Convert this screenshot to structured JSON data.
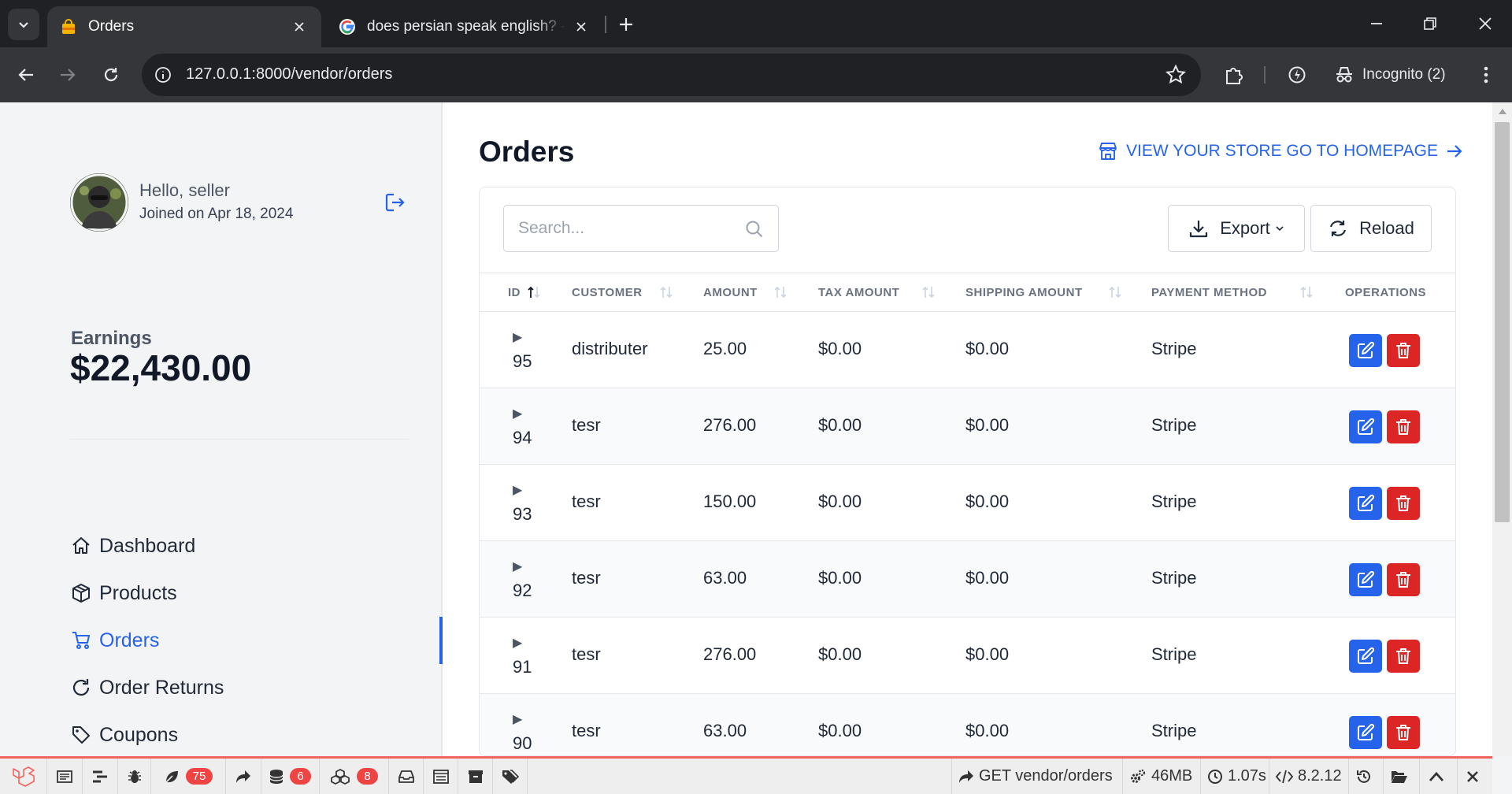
{
  "browser": {
    "tabs": [
      {
        "title": "Orders",
        "active": true
      },
      {
        "title": "does persian speak english? - G",
        "active": false
      }
    ],
    "url": "127.0.0.1:8000/vendor/orders",
    "profile_label": "Incognito (2)"
  },
  "user": {
    "greeting": "Hello, seller",
    "joined": "Joined on Apr 18, 2024"
  },
  "earnings": {
    "label": "Earnings",
    "value": "$22,430.00"
  },
  "nav": [
    {
      "label": "Dashboard",
      "icon": "home-icon"
    },
    {
      "label": "Products",
      "icon": "box-icon"
    },
    {
      "label": "Orders",
      "icon": "cart-icon",
      "active": true
    },
    {
      "label": "Order Returns",
      "icon": "refresh-icon"
    },
    {
      "label": "Coupons",
      "icon": "tag-icon"
    }
  ],
  "page": {
    "title": "Orders",
    "store_link": "VIEW YOUR STORE GO TO HOMEPAGE"
  },
  "table": {
    "search_placeholder": "Search...",
    "export_label": "Export",
    "reload_label": "Reload",
    "columns": [
      "ID",
      "CUSTOMER",
      "AMOUNT",
      "TAX AMOUNT",
      "SHIPPING AMOUNT",
      "PAYMENT METHOD",
      "OPERATIONS"
    ],
    "rows": [
      {
        "id": "95",
        "customer": "distributer",
        "amount": "25.00",
        "tax": "$0.00",
        "shipping": "$0.00",
        "payment": "Stripe"
      },
      {
        "id": "94",
        "customer": "tesr",
        "amount": "276.00",
        "tax": "$0.00",
        "shipping": "$0.00",
        "payment": "Stripe"
      },
      {
        "id": "93",
        "customer": "tesr",
        "amount": "150.00",
        "tax": "$0.00",
        "shipping": "$0.00",
        "payment": "Stripe"
      },
      {
        "id": "92",
        "customer": "tesr",
        "amount": "63.00",
        "tax": "$0.00",
        "shipping": "$0.00",
        "payment": "Stripe"
      },
      {
        "id": "91",
        "customer": "tesr",
        "amount": "276.00",
        "tax": "$0.00",
        "shipping": "$0.00",
        "payment": "Stripe"
      },
      {
        "id": "90",
        "customer": "tesr",
        "amount": "63.00",
        "tax": "$0.00",
        "shipping": "$0.00",
        "payment": "Stripe"
      }
    ]
  },
  "debugbar": {
    "badges": {
      "views": "75",
      "queries": "6",
      "models": "8"
    },
    "request": "GET vendor/orders",
    "memory": "46MB",
    "time": "1.07s",
    "php_version": "8.2.12"
  },
  "colors": {
    "accent": "#2563eb",
    "danger": "#dc2626",
    "debugbar_accent": "#f4645f"
  }
}
